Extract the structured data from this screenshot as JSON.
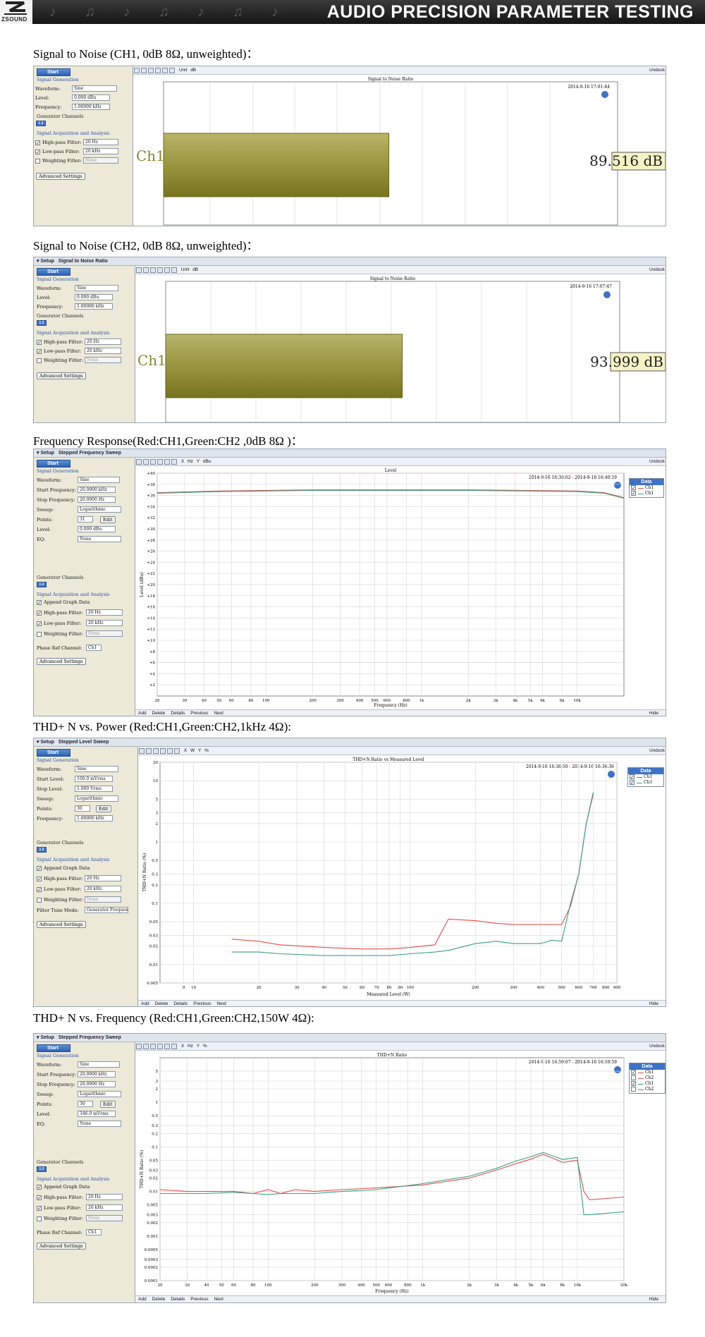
{
  "header": {
    "brand": "ZSOUND",
    "title": "AUDIO PRECISION PARAMETER TESTING"
  },
  "sections": {
    "snr_ch1": "Signal to Noise (CH1, 0dB 8Ω, unweighted)：",
    "snr_ch2": "Signal to Noise (CH2, 0dB 8Ω, unweighted)：",
    "freq_resp": "Frequency Response(Red:CH1,Green:CH2 ,0dB 8Ω )：",
    "thd_power": "THD+ N vs. Power (Red:CH1,Green:CH2,1kHz 4Ω):",
    "thd_freq": "THD+ N vs. Frequency (Red:CH1,Green:CH2,150W 4Ω):"
  },
  "colors": {
    "ch1": "#e0504c",
    "ch2": "#3aa083",
    "bar_top": "#b8b46a",
    "bar_bottom": "#77731d",
    "accent": "#3e72c4"
  },
  "common": {
    "start": "Start",
    "setup": "Setup",
    "undock": "Undock",
    "unit": "Unit",
    "signal_generation": "Signal Generation",
    "signal_acquisition": "Signal Acquisition and Analysis",
    "generator_channels": "Generator Channels",
    "waveform_label": "Waveform:",
    "waveform": "Sine",
    "level_label": "Level:",
    "frequency_label": "Frequency:",
    "highpass_label": "High-pass Filter:",
    "highpass": "20 Hz",
    "lowpass_label": "Low-pass Filter:",
    "lowpass": "20 kHz",
    "weighting_label": "Weighting Filter:",
    "weighting": "None",
    "advanced": "Advanced Settings",
    "start_freq_label": "Start Frequency:",
    "stop_freq_label": "Stop Frequency:",
    "start_level_label": "Start Level:",
    "stop_level_label": "Stop Level:",
    "sweep_label": "Sweep:",
    "sweep": "Logarithmic",
    "points_label": "Points:",
    "edit": "Edit",
    "eq_label": "EQ:",
    "eq": "None",
    "append": "Append Graph Data",
    "phase_ref_label": "Phase Ref Channel:",
    "phase_ref": "Ch1",
    "filter_tune_label": "Filter Tune Mode:",
    "filter_tune": "Generator Frequen",
    "add": "Add",
    "delete": "Delete",
    "details": "Details",
    "previous": "Previous",
    "next": "Next",
    "hide": "Hide",
    "data": "Data",
    "ch1": "Ch1",
    "ch2": "Ch2"
  },
  "snr1": {
    "unit_value": "dB",
    "plot_title": "Signal to Noise Ratio",
    "timestamp": "2014-9-16 17:01:44",
    "level": "0.000 dBu",
    "frequency": "1.00000 kHz"
  },
  "snr2": {
    "setup_title": "Signal to Noise Ratio",
    "unit_value": "dB",
    "plot_title": "Signal to Noise Ratio",
    "timestamp": "2014-9-16 17:07:47",
    "level": "0.000 dBu",
    "frequency": "1.00000 kHz"
  },
  "fr": {
    "setup_title": "Stepped Frequency Sweep",
    "x_unit": "Hz",
    "y_unit": "dBu",
    "plot_title": "Level",
    "timestamp": "2014-9-16 16:38:02 - 2014-9-16 16:40:19",
    "start_freq": "20.0000 kHz",
    "stop_freq": "20.0000 Hz",
    "points": "31",
    "level": "0.000 dBu",
    "ylabel": "Level (dBu)",
    "xlabel": "Frequency (Hz)"
  },
  "tp": {
    "setup_title": "Stepped Level Sweep",
    "x_unit": "W",
    "y_unit": "%",
    "plot_title": "THD+N Ratio vs Measured Level",
    "timestamp": "2014-9-16 16:36:50 - 2014-9-16 16:36:36",
    "start_level": "100.0 mVrms",
    "stop_level": "1.000 Vrms",
    "points": "30",
    "frequency": "1.00000 kHz",
    "ylabel": "THD+N Ratio (%)",
    "xlabel": "Measured Level (W)"
  },
  "tf": {
    "setup_title": "Stepped Frequency Sweep",
    "x_unit": "Hz",
    "y_unit": "%",
    "plot_title": "THD+N Ratio",
    "timestamp": "2014-9-16 16:59:07 - 2014-9-16 16:59:59",
    "start_freq": "20.0000 kHz",
    "stop_freq": "20.0000 Hz",
    "points": "30",
    "level": "346.0 mVrms",
    "ylabel": "THD+N Ratio (%)",
    "xlabel": "Frequency (Hz)"
  },
  "chart_data": [
    {
      "type": "bar",
      "title": "Signal to Noise Ratio",
      "categories": [
        "Ch1"
      ],
      "values": [
        89.516
      ],
      "value_label": "89.516 dB"
    },
    {
      "type": "bar",
      "title": "Signal to Noise Ratio",
      "categories": [
        "Ch1"
      ],
      "values": [
        93.999
      ],
      "value_label": "93.999 dB"
    },
    {
      "type": "line",
      "title": "Level",
      "xlabel": "Frequency (Hz)",
      "ylabel": "Level (dBu)",
      "xscale": "log",
      "xlim": [
        20,
        20000
      ],
      "ylim": [
        0,
        40
      ],
      "x_ticks": [
        "20",
        "30",
        "40",
        "50",
        "60",
        "80",
        "100",
        "200",
        "300",
        "400",
        "500",
        "600",
        "800",
        "1k",
        "2k",
        "3k",
        "4k",
        "5k",
        "6k",
        "8k",
        "10k"
      ],
      "x_tick_values": [
        20,
        30,
        40,
        50,
        60,
        80,
        100,
        200,
        300,
        400,
        500,
        600,
        800,
        1000,
        2000,
        3000,
        4000,
        5000,
        6000,
        8000,
        10000
      ],
      "y_ticks": [
        "+40",
        "+38",
        "+36",
        "+34",
        "+32",
        "+30",
        "+28",
        "+26",
        "+24",
        "+22",
        "+20",
        "+18",
        "+16",
        "+14",
        "+12",
        "+10",
        "+8",
        "+6",
        "+4",
        "+2"
      ],
      "y_tick_values": [
        40,
        38,
        36,
        34,
        32,
        30,
        28,
        26,
        24,
        22,
        20,
        18,
        16,
        14,
        12,
        10,
        8,
        6,
        4,
        2
      ],
      "legend": [
        "Ch1",
        "Ch1"
      ],
      "series": [
        {
          "name": "Ch1",
          "color": "#e0504c",
          "x": [
            20,
            50,
            100,
            200,
            500,
            1000,
            2000,
            5000,
            10000,
            15000,
            20000
          ],
          "y": [
            36.5,
            36.8,
            36.9,
            37.0,
            37.0,
            37.0,
            37.0,
            36.9,
            36.8,
            36.5,
            35.6
          ]
        },
        {
          "name": "Ch1",
          "color": "#3aa083",
          "x": [
            20,
            50,
            100,
            200,
            500,
            1000,
            2000,
            5000,
            10000,
            15000,
            20000
          ],
          "y": [
            36.4,
            36.7,
            36.8,
            36.9,
            36.9,
            36.9,
            36.9,
            36.8,
            36.7,
            36.4,
            35.5
          ]
        }
      ]
    },
    {
      "type": "line",
      "title": "THD+N Ratio vs Measured Level",
      "xlabel": "Measured Level (W)",
      "ylabel": "THD+N Ratio (%)",
      "xscale": "log",
      "yscale": "log",
      "xlim": [
        7,
        900
      ],
      "ylim": [
        0.005,
        20
      ],
      "x_ticks": [
        "9",
        "10",
        "20",
        "30",
        "40",
        "50",
        "60",
        "70",
        "80",
        "90",
        "100",
        "200",
        "300",
        "400",
        "500",
        "600",
        "700",
        "800",
        "900"
      ],
      "x_tick_values": [
        9,
        10,
        20,
        30,
        40,
        50,
        60,
        70,
        80,
        90,
        100,
        200,
        300,
        400,
        500,
        600,
        700,
        800,
        900
      ],
      "y_ticks": [
        "20",
        "10",
        "5",
        "3",
        "2",
        "1",
        "0.5",
        "0.3",
        "0.2",
        "0.1",
        "0.05",
        "0.03",
        "0.02",
        "0.01",
        "0.005"
      ],
      "y_tick_values": [
        20,
        10,
        5,
        3,
        2,
        1,
        0.5,
        0.3,
        0.2,
        0.1,
        0.05,
        0.03,
        0.02,
        0.01,
        0.005
      ],
      "legend": [
        "Ch1",
        "Ch1"
      ],
      "series": [
        {
          "name": "Ch1",
          "color": "#e0504c",
          "x": [
            15,
            20,
            25,
            40,
            60,
            80,
            100,
            130,
            150,
            200,
            250,
            300,
            400,
            500,
            550,
            600,
            650,
            700
          ],
          "y": [
            0.026,
            0.024,
            0.021,
            0.019,
            0.018,
            0.018,
            0.019,
            0.021,
            0.055,
            0.052,
            0.047,
            0.045,
            0.045,
            0.045,
            0.09,
            0.3,
            2.0,
            6.0
          ]
        },
        {
          "name": "Ch1",
          "color": "#3aa083",
          "x": [
            15,
            20,
            25,
            40,
            60,
            80,
            100,
            130,
            150,
            200,
            250,
            300,
            400,
            450,
            500,
            550,
            600,
            650,
            700
          ],
          "y": [
            0.016,
            0.016,
            0.015,
            0.014,
            0.014,
            0.014,
            0.015,
            0.016,
            0.017,
            0.022,
            0.024,
            0.022,
            0.022,
            0.025,
            0.024,
            0.1,
            0.3,
            2.0,
            6.5
          ]
        }
      ]
    },
    {
      "type": "line",
      "title": "THD+N Ratio",
      "xlabel": "Frequency (Hz)",
      "ylabel": "THD+N Ratio (%)",
      "xscale": "log",
      "yscale": "log",
      "xlim": [
        20,
        20000
      ],
      "ylim": [
        0.0001,
        10
      ],
      "x_ticks": [
        "20",
        "30",
        "40",
        "50",
        "60",
        "80",
        "100",
        "200",
        "300",
        "400",
        "500",
        "600",
        "800",
        "1k",
        "2k",
        "3k",
        "4k",
        "5k",
        "6k",
        "8k",
        "10k",
        "20k"
      ],
      "x_tick_values": [
        20,
        30,
        40,
        50,
        60,
        80,
        100,
        200,
        300,
        400,
        500,
        600,
        800,
        1000,
        2000,
        3000,
        4000,
        5000,
        6000,
        8000,
        10000,
        20000
      ],
      "y_ticks": [
        "5",
        "3",
        "2",
        "1",
        "0.5",
        "0.3",
        "0.2",
        "0.1",
        "0.05",
        "0.03",
        "0.02",
        "0.01",
        "0.005",
        "0.003",
        "0.002",
        "0.001",
        "0.0005",
        "0.0003",
        "0.0002",
        "0.0001"
      ],
      "y_tick_values": [
        5,
        3,
        2,
        1,
        0.5,
        0.3,
        0.2,
        0.1,
        0.05,
        0.03,
        0.02,
        0.01,
        0.005,
        0.003,
        0.002,
        0.001,
        0.0005,
        0.0003,
        0.0002,
        0.0001
      ],
      "legend": [
        "Ch1",
        "Ch2",
        "Ch1",
        "Ch2"
      ],
      "series": [
        {
          "name": "Ch1",
          "color": "#e0504c",
          "x": [
            20,
            30,
            40,
            60,
            80,
            100,
            120,
            150,
            200,
            300,
            500,
            1000,
            2000,
            3000,
            4000,
            5000,
            6000,
            7000,
            8000,
            10000,
            11000,
            12000,
            20000
          ],
          "y": [
            0.011,
            0.01,
            0.01,
            0.01,
            0.009,
            0.011,
            0.009,
            0.011,
            0.01,
            0.011,
            0.012,
            0.014,
            0.02,
            0.03,
            0.042,
            0.053,
            0.068,
            0.055,
            0.045,
            0.05,
            0.01,
            0.0065,
            0.0075
          ]
        },
        {
          "name": "Ch2",
          "color": "#3aa083",
          "x": [
            20,
            30,
            40,
            60,
            80,
            100,
            120,
            150,
            200,
            300,
            500,
            1000,
            2000,
            3000,
            4000,
            5000,
            6000,
            7000,
            8000,
            10000,
            11000,
            12000,
            20000
          ],
          "y": [
            0.009,
            0.009,
            0.009,
            0.0095,
            0.009,
            0.0085,
            0.009,
            0.009,
            0.009,
            0.01,
            0.011,
            0.015,
            0.022,
            0.033,
            0.048,
            0.06,
            0.075,
            0.062,
            0.052,
            0.058,
            0.003,
            0.003,
            0.0035
          ]
        }
      ]
    }
  ]
}
